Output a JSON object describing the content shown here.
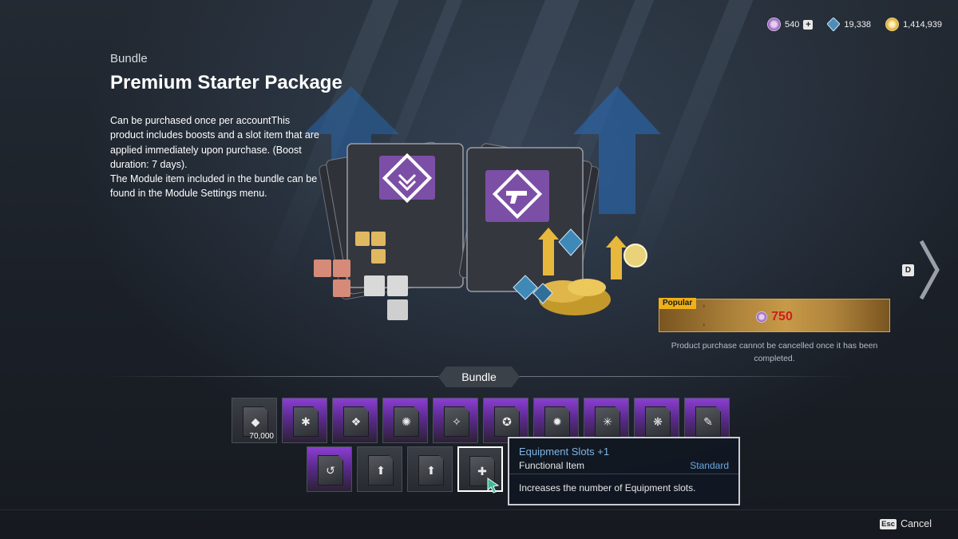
{
  "currencies": [
    {
      "icon": "caliber-icon",
      "value": "540",
      "has_plus": true,
      "color": "#b67fd6"
    },
    {
      "icon": "kuiper-shard-icon",
      "value": "19,338",
      "color": "#7fb4d6"
    },
    {
      "icon": "gold-icon",
      "value": "1,414,939",
      "color": "#e5c35a"
    }
  ],
  "header": {
    "category": "Bundle",
    "title": "Premium Starter Package",
    "description": "Can be purchased once per accountThis product includes boosts and a slot item that are applied immediately upon purchase. (Boost duration: 7 days).\nThe Module item included in the bundle can be found in the Module Settings menu."
  },
  "navigation": {
    "next_key": "D"
  },
  "purchase": {
    "badge": "Popular",
    "price": "750",
    "currency_icon": "caliber-icon",
    "note": "Product purchase cannot be cancelled once it has been completed.",
    "price_color": "#d01c1c",
    "accent": "#f0b018"
  },
  "bundle": {
    "tab_label": "Bundle",
    "row1": [
      {
        "name": "kuiper-shard-item",
        "qty": "70,000",
        "style": "plain",
        "glyph": "◆"
      },
      {
        "name": "module-item-1",
        "style": "purple",
        "glyph": "✱"
      },
      {
        "name": "module-item-2",
        "style": "purple",
        "glyph": "❖"
      },
      {
        "name": "module-item-3",
        "style": "purple",
        "glyph": "✺"
      },
      {
        "name": "module-item-4",
        "style": "purple",
        "glyph": "✧"
      },
      {
        "name": "module-item-5",
        "style": "purple",
        "glyph": "✪"
      },
      {
        "name": "module-item-6",
        "style": "purple",
        "glyph": "✹"
      },
      {
        "name": "module-item-7",
        "style": "purple",
        "glyph": "✳"
      },
      {
        "name": "module-item-8",
        "style": "purple",
        "glyph": "❋"
      },
      {
        "name": "module-item-9",
        "style": "purple",
        "glyph": "✎"
      }
    ],
    "row2": [
      {
        "name": "module-item-10",
        "style": "purple",
        "glyph": "↺"
      },
      {
        "name": "gold-boost-item",
        "style": "plain",
        "glyph": "⬆"
      },
      {
        "name": "kuiper-boost-item",
        "style": "plain",
        "glyph": "⬆"
      },
      {
        "name": "equipment-slot-item",
        "style": "plain",
        "glyph": "✚",
        "selected": true
      }
    ]
  },
  "tooltip": {
    "title": "Equipment Slots +1",
    "type": "Functional Item",
    "grade": "Standard",
    "description": "Increases the number of Equipment slots."
  },
  "footer": {
    "key": "Esc",
    "label": "Cancel"
  }
}
